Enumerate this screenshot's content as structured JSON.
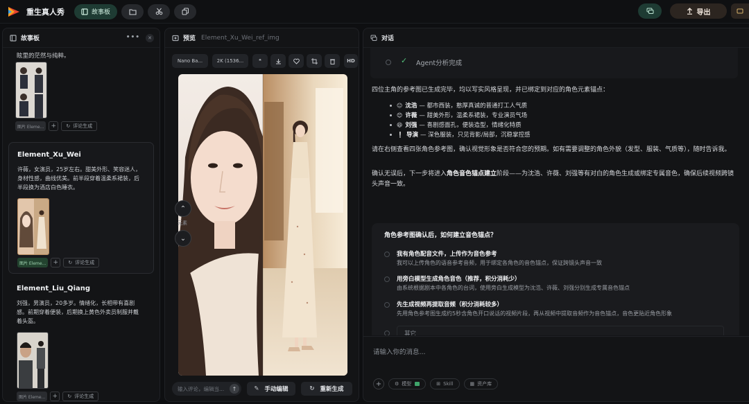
{
  "app": {
    "title": "重生真人秀"
  },
  "toolbar": {
    "storyboard_label": "故事板",
    "export_label": "导出"
  },
  "sidebar": {
    "title": "故事板",
    "top_text": "眩里的茫然与纯粹。",
    "cards": [
      {
        "name": "",
        "desc": [],
        "chip_label": "图片 Eleme...",
        "comment_label": "评论生成"
      },
      {
        "name": "Element_Xu_Wei",
        "desc": [
          "许薇，女演员，25岁左右。甜美外形、笑容迷人，",
          "身材性感，曲线优美。前半段穿着温柔系裙装，后",
          "半段换为酒店白色睡衣。"
        ],
        "chip_label": "图片 Eleme...",
        "comment_label": "评论生成"
      },
      {
        "name": "Element_Liu_Qiang",
        "desc": [
          "刘强，男演员，20多岁。情绪化，长相带有喜剧",
          "感。前期穿着便装，后期换上黄色外卖员制服并戴",
          "着头盔。"
        ],
        "chip_label": "图片 Eleme...",
        "comment_label": "评论生成"
      }
    ]
  },
  "preview": {
    "title": "预览",
    "filename": "Element_Xu_Wei_ref_img",
    "model_chip": "Nano Ba...",
    "res_chip": "2K (1536...",
    "hd_label": "HD",
    "nav_label": "元素",
    "comment_placeholder": "输入评论，编辑当...",
    "manual_edit_label": "手动编辑",
    "regenerate_label": "重新生成"
  },
  "chat": {
    "title": "对话",
    "agent_status": "Agent分析完成",
    "intro": "四位主角的参考图已生成完毕，均以写实风格呈现，并已绑定到对应的角色元素锚点：",
    "roles": [
      {
        "emoji": "😐",
        "name": "沈浩",
        "desc": "— 都市西装，憨厚真诚的普通打工人气质"
      },
      {
        "emoji": "😊",
        "name": "许薇",
        "desc": "— 甜美外形，温柔系裙装，专业演员气场"
      },
      {
        "emoji": "😆",
        "name": "刘强",
        "desc": "— 喜剧感面孔，便装造型，情绪化特质"
      },
      {
        "emoji": "❕",
        "name": "导演",
        "desc": "— 深色服装，只见背影/局部，沉稳掌控感"
      }
    ],
    "para2": "请在右侧查看四张角色参考图，确认视觉形象是否符合您的预期。如有需要调整的角色外貌（发型、服装、气质等），随时告诉我。",
    "para3_pre": "确认无误后，下一步将进入",
    "para3_bold": "角色音色锚点建立",
    "para3_post": "阶段——为沈浩、许薇、刘强等有对白的角色生成或绑定专属音色，确保后续视频跨镜头声音一致。",
    "question": "角色参考图确认后，如何建立音色锚点？",
    "options": [
      {
        "title": "我有角色配音文件，上传作为音色参考",
        "desc": "我可以上传角色的语音参考音频，用于绑定各角色的音色锚点，保证跨镜头声音一致"
      },
      {
        "title": "用旁白模型生成角色音色（推荐，积分消耗少）",
        "desc": "由系统根据剧本中各角色的台词，使用旁白生成模型为沈浩、许薇、刘强分别生成专属音色锚点"
      },
      {
        "title": "先生成视频再提取音频（积分消耗较多）",
        "desc": "先用角色参考图生成约5秒含角色开口说话的视频片段，再从视频中提取音频作为音色锚点，音色更贴近角色形象"
      }
    ],
    "other_placeholder": "其它",
    "input_placeholder": "请输入你的消息...",
    "tools": [
      "模型",
      "Skill",
      "资产库"
    ]
  }
}
